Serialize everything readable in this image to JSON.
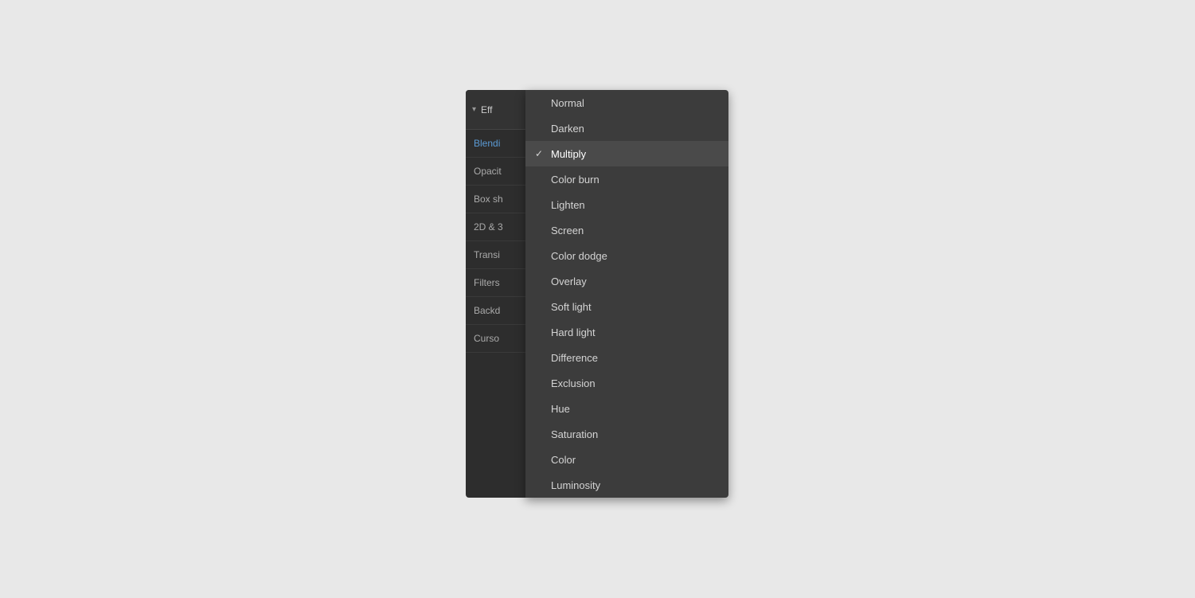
{
  "background_color": "#e8e8e8",
  "panel": {
    "title": "Eff",
    "chevron": "▾",
    "rows": [
      {
        "id": "blending",
        "label": "Blendi",
        "color": "blue"
      },
      {
        "id": "opacity",
        "label": "Opacit",
        "color": "normal"
      },
      {
        "id": "box-shadow",
        "label": "Box sh",
        "color": "normal"
      },
      {
        "id": "2d3d",
        "label": "2D & 3",
        "color": "normal"
      },
      {
        "id": "transition",
        "label": "Transi",
        "color": "normal"
      },
      {
        "id": "filters",
        "label": "Filters",
        "color": "normal"
      },
      {
        "id": "backdrop",
        "label": "Backd",
        "color": "normal"
      },
      {
        "id": "cursor",
        "label": "Curso",
        "color": "normal"
      }
    ]
  },
  "dropdown": {
    "items": [
      {
        "id": "normal",
        "label": "Normal",
        "selected": false,
        "checked": false
      },
      {
        "id": "darken",
        "label": "Darken",
        "selected": false,
        "checked": false
      },
      {
        "id": "multiply",
        "label": "Multiply",
        "selected": true,
        "checked": true
      },
      {
        "id": "color-burn",
        "label": "Color burn",
        "selected": false,
        "checked": false
      },
      {
        "id": "lighten",
        "label": "Lighten",
        "selected": false,
        "checked": false
      },
      {
        "id": "screen",
        "label": "Screen",
        "selected": false,
        "checked": false
      },
      {
        "id": "color-dodge",
        "label": "Color dodge",
        "selected": false,
        "checked": false
      },
      {
        "id": "overlay",
        "label": "Overlay",
        "selected": false,
        "checked": false
      },
      {
        "id": "soft-light",
        "label": "Soft light",
        "selected": false,
        "checked": false
      },
      {
        "id": "hard-light",
        "label": "Hard light",
        "selected": false,
        "checked": false
      },
      {
        "id": "difference",
        "label": "Difference",
        "selected": false,
        "checked": false
      },
      {
        "id": "exclusion",
        "label": "Exclusion",
        "selected": false,
        "checked": false
      },
      {
        "id": "hue",
        "label": "Hue",
        "selected": false,
        "checked": false
      },
      {
        "id": "saturation",
        "label": "Saturation",
        "selected": false,
        "checked": false
      },
      {
        "id": "color",
        "label": "Color",
        "selected": false,
        "checked": false
      },
      {
        "id": "luminosity",
        "label": "Luminosity",
        "selected": false,
        "checked": false
      }
    ]
  }
}
